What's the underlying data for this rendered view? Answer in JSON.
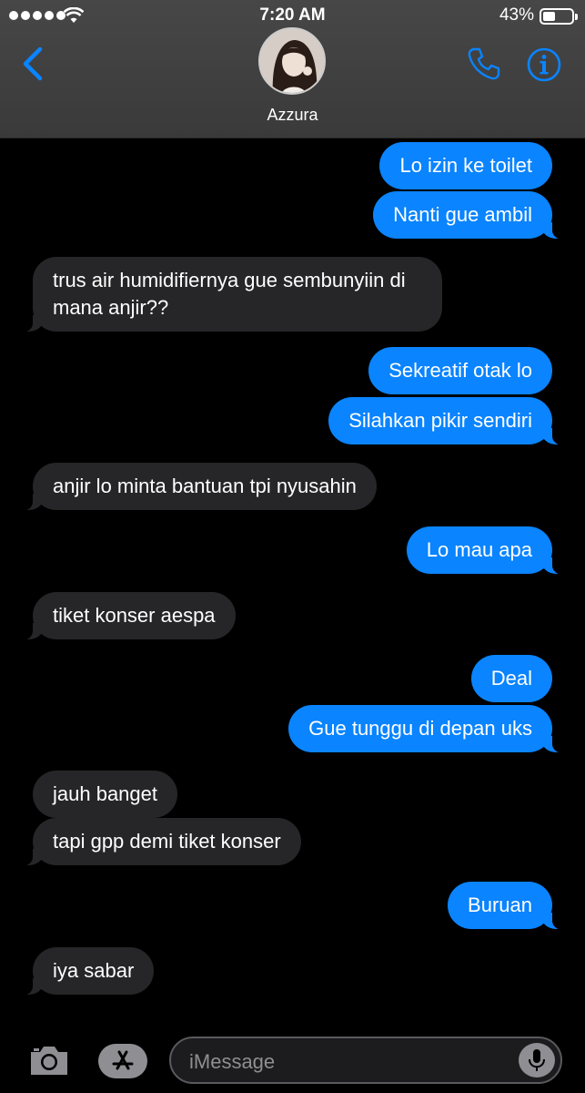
{
  "status_bar": {
    "time": "7:20 AM",
    "battery_percent": "43%",
    "battery_level": 0.43,
    "signal_bars": 5
  },
  "header": {
    "contact_name": "Azzura",
    "back_icon": "chevron-left-icon",
    "call_icon": "phone-icon",
    "info_icon": "info-icon"
  },
  "colors": {
    "accent": "#0a84ff",
    "incoming_bubble": "#262628",
    "background": "#000000"
  },
  "messages": [
    {
      "from": "me",
      "text": "Lo izin ke toilet"
    },
    {
      "from": "me",
      "text": "Nanti gue ambil"
    },
    {
      "from": "them",
      "text": "trus air humidifiernya gue sembunyiin di mana anjir??"
    },
    {
      "from": "me",
      "text": "Sekreatif otak lo"
    },
    {
      "from": "me",
      "text": "Silahkan pikir sendiri"
    },
    {
      "from": "them",
      "text": "anjir lo minta bantuan tpi nyusahin"
    },
    {
      "from": "me",
      "text": "Lo mau apa"
    },
    {
      "from": "them",
      "text": "tiket konser aespa"
    },
    {
      "from": "me",
      "text": "Deal"
    },
    {
      "from": "me",
      "text": "Gue tunggu di depan uks"
    },
    {
      "from": "them",
      "text": "jauh banget"
    },
    {
      "from": "them",
      "text": "tapi gpp demi tiket konser"
    },
    {
      "from": "me",
      "text": "Buruan"
    },
    {
      "from": "them",
      "text": "iya sabar"
    }
  ],
  "composer": {
    "placeholder": "iMessage",
    "camera_icon": "camera-icon",
    "apps_icon": "app-store-icon",
    "mic_icon": "microphone-icon"
  }
}
